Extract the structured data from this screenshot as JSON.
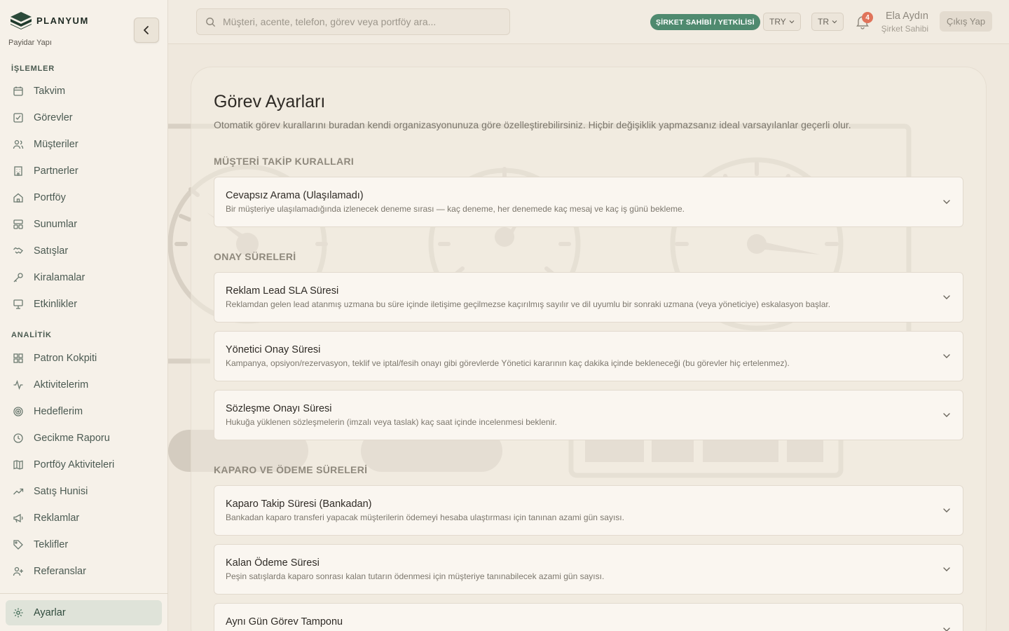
{
  "brand": {
    "name": "PLANYUM",
    "subtitle": "Payidar Yapı"
  },
  "sidebar": {
    "sections": [
      {
        "label": "İŞLEMLER"
      },
      {
        "label": "ANALİTİK"
      }
    ],
    "items": [
      {
        "label": "Takvim",
        "icon": "calendar-icon"
      },
      {
        "label": "Görevler",
        "icon": "checklist-icon"
      },
      {
        "label": "Müşteriler",
        "icon": "users-icon"
      },
      {
        "label": "Partnerler",
        "icon": "building-icon"
      },
      {
        "label": "Portföy",
        "icon": "home-icon"
      },
      {
        "label": "Sunumlar",
        "icon": "layout-icon"
      },
      {
        "label": "Satışlar",
        "icon": "handshake-icon"
      },
      {
        "label": "Kiralamalar",
        "icon": "key-icon"
      },
      {
        "label": "Etkinlikler",
        "icon": "presentation-icon"
      },
      {
        "label": "Patron Kokpiti",
        "icon": "grid-icon"
      },
      {
        "label": "Aktivitelerim",
        "icon": "activity-icon"
      },
      {
        "label": "Hedeflerim",
        "icon": "target-icon"
      },
      {
        "label": "Gecikme Raporu",
        "icon": "clock-icon"
      },
      {
        "label": "Portföy Aktiviteleri",
        "icon": "map-icon"
      },
      {
        "label": "Satış Hunisi",
        "icon": "trending-up-icon"
      },
      {
        "label": "Reklamlar",
        "icon": "megaphone-icon"
      },
      {
        "label": "Teklifler",
        "icon": "tag-icon"
      },
      {
        "label": "Referanslar",
        "icon": "user-plus-icon"
      },
      {
        "label": "Ayarlar",
        "icon": "gear-icon"
      }
    ]
  },
  "header": {
    "search_placeholder": "Müşteri, acente, telefon, görev veya portföy ara...",
    "role_badge": "ŞİRKET SAHİBİ / YETKİLİSİ",
    "currency": "TRY",
    "language": "TR",
    "notification_count": "4",
    "user_name": "Ela Aydın",
    "user_role": "Şirket Sahibi",
    "logout_label": "Çıkış Yap"
  },
  "page": {
    "title": "Görev Ayarları",
    "description": "Otomatik görev kurallarını buradan kendi organizasyonunuza göre özelleştirebilirsiniz. Hiçbir değişiklik yapmazsanız ideal varsayılanlar geçerli olur.",
    "groups": [
      {
        "title": "MÜŞTERİ TAKİP KURALLARI",
        "cards": [
          {
            "title": "Cevapsız Arama (Ulaşılamadı)",
            "desc": "Bir müşteriye ulaşılamadığında izlenecek deneme sırası — kaç deneme, her denemede kaç mesaj ve kaç iş günü bekleme."
          }
        ]
      },
      {
        "title": "ONAY SÜRELERİ",
        "cards": [
          {
            "title": "Reklam Lead SLA Süresi",
            "desc": "Reklamdan gelen lead atanmış uzmana bu süre içinde iletişime geçilmezse kaçırılmış sayılır ve dil uyumlu bir sonraki uzmana (veya yöneticiye) eskalasyon başlar."
          },
          {
            "title": "Yönetici Onay Süresi",
            "desc": "Kampanya, opsiyon/rezervasyon, teklif ve iptal/fesih onayı gibi görevlerde Yönetici kararının kaç dakika içinde bekleneceği (bu görevler hiç ertelenmez)."
          },
          {
            "title": "Sözleşme Onayı Süresi",
            "desc": "Hukuğa yüklenen sözleşmelerin (imzalı veya taslak) kaç saat içinde incelenmesi beklenir."
          }
        ]
      },
      {
        "title": "KAPARO VE ÖDEME SÜRELERİ",
        "cards": [
          {
            "title": "Kaparo Takip Süresi (Bankadan)",
            "desc": "Bankadan kaparo transferi yapacak müşterilerin ödemeyi hesaba ulaştırması için tanınan azami gün sayısı."
          },
          {
            "title": "Kalan Ödeme Süresi",
            "desc": "Peşin satışlarda kaparo sonrası kalan tutarın ödenmesi için müşteriye tanınabilecek azami gün sayısı."
          },
          {
            "title": "Aynı Gün Görev Tamponu",
            "desc": ""
          }
        ]
      }
    ]
  },
  "colors": {
    "accent": "#4f8a6f",
    "active_nav_bg": "#dfe3d9",
    "badge": "#e0735a"
  }
}
